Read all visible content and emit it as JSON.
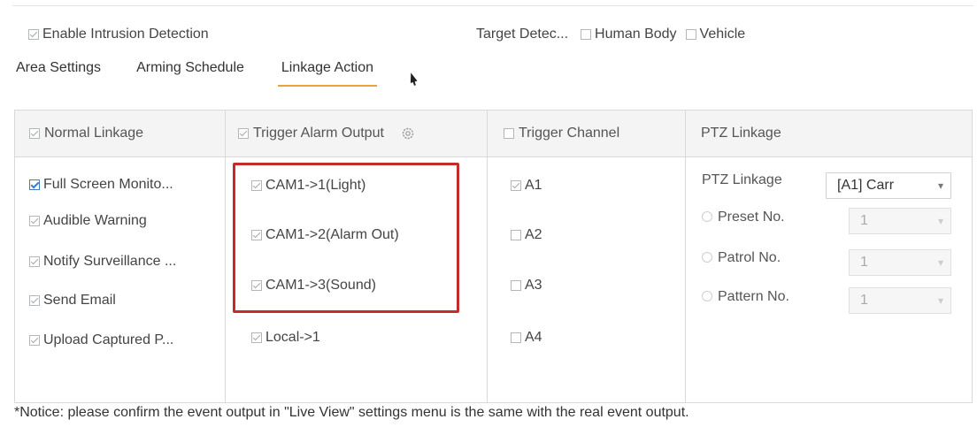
{
  "header": {
    "enable_intrusion": {
      "label": "Enable Intrusion Detection",
      "checked": true
    },
    "target_detection": {
      "label": "Target Detec...",
      "options": [
        {
          "label": "Human Body",
          "checked": false
        },
        {
          "label": "Vehicle",
          "checked": false
        }
      ]
    }
  },
  "tabs": [
    {
      "label": "Area Settings",
      "active": false
    },
    {
      "label": "Arming Schedule",
      "active": false
    },
    {
      "label": "Linkage Action",
      "active": true
    }
  ],
  "columns": {
    "normal_linkage": {
      "header": "Normal Linkage",
      "items": [
        {
          "label": "Full Screen Monito...",
          "checked": true
        },
        {
          "label": "Audible Warning",
          "checked": true
        },
        {
          "label": "Notify Surveillance ...",
          "checked": true
        },
        {
          "label": "Send Email",
          "checked": true
        },
        {
          "label": "Upload Captured P...",
          "checked": true
        }
      ]
    },
    "trigger_alarm_output": {
      "header": "Trigger Alarm Output",
      "items": [
        {
          "label": "CAM1->1(Light)",
          "checked": true
        },
        {
          "label": "CAM1->2(Alarm Out)",
          "checked": true
        },
        {
          "label": "CAM1->3(Sound)",
          "checked": true
        },
        {
          "label": "Local->1",
          "checked": true
        }
      ]
    },
    "trigger_channel": {
      "header": "Trigger Channel",
      "items": [
        {
          "label": "A1",
          "checked": true
        },
        {
          "label": "A2",
          "checked": false
        },
        {
          "label": "A3",
          "checked": false
        },
        {
          "label": "A4",
          "checked": false
        }
      ]
    },
    "ptz_linkage": {
      "header": "PTZ Linkage",
      "linkage_label": "PTZ Linkage",
      "linkage_value": "[A1] Carr",
      "preset_label": "Preset No.",
      "preset_value": "1",
      "patrol_label": "Patrol No.",
      "patrol_value": "1",
      "pattern_label": "Pattern No.",
      "pattern_value": "1"
    }
  },
  "notice": "*Notice: please confirm the event output in \"Live View\" settings menu is the same with the real event output."
}
